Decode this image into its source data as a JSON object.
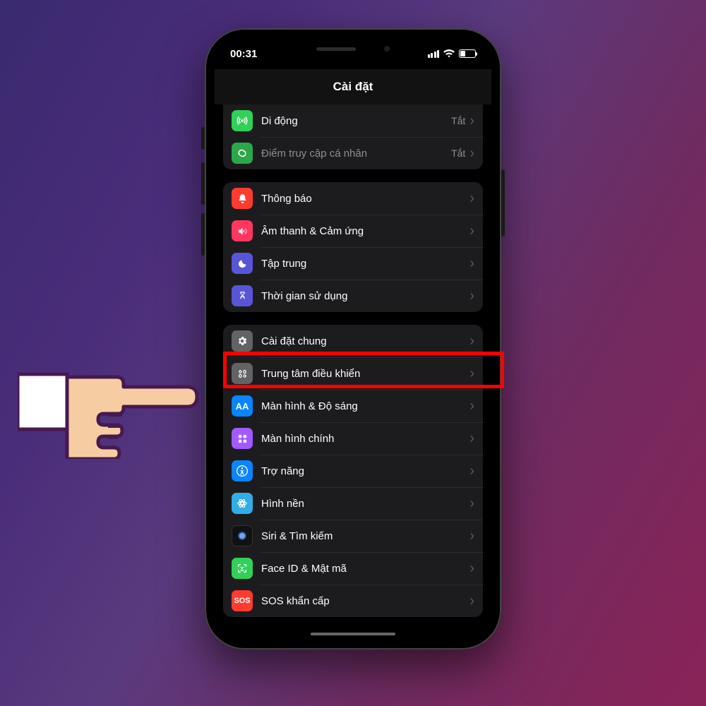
{
  "statusbar": {
    "time": "00:31"
  },
  "header": {
    "title": "Cài đặt"
  },
  "group1": {
    "items": [
      {
        "label": "Di động",
        "value": "Tắt"
      },
      {
        "label": "Điểm truy cập cá nhân",
        "value": "Tắt"
      }
    ]
  },
  "group2": {
    "items": [
      {
        "label": "Thông báo"
      },
      {
        "label": "Âm thanh & Cảm ứng"
      },
      {
        "label": "Tập trung"
      },
      {
        "label": "Thời gian sử dụng"
      }
    ]
  },
  "group3": {
    "items": [
      {
        "label": "Cài đặt chung"
      },
      {
        "label": "Trung tâm điều khiển"
      },
      {
        "label": "Màn hình & Độ sáng"
      },
      {
        "label": "Màn hình chính"
      },
      {
        "label": "Trợ năng"
      },
      {
        "label": "Hình nền"
      },
      {
        "label": "Siri & Tìm kiếm"
      },
      {
        "label": "Face ID & Mật mã"
      },
      {
        "label": "SOS khẩn cấp"
      }
    ]
  },
  "icons": {
    "aa": "AA",
    "sos": "SOS"
  }
}
